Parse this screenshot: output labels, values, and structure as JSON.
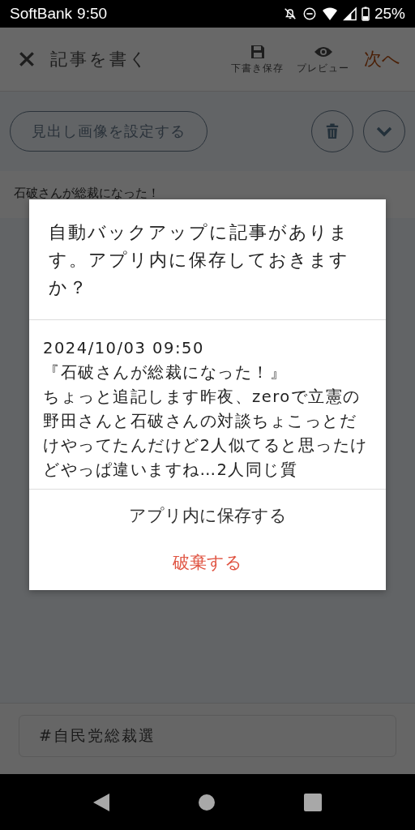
{
  "status_bar": {
    "carrier": "SoftBank",
    "time": "9:50",
    "battery": "25%"
  },
  "header": {
    "title": "記事を書く",
    "actions": [
      {
        "label": "下書き保存",
        "kind": "save"
      },
      {
        "label": "プレビュー",
        "kind": "preview"
      }
    ],
    "next": "次へ"
  },
  "toolbar": {
    "cover_button": "見出し画像を設定する"
  },
  "article_title": "石破さんが総裁になった！",
  "dialog": {
    "message": "自動バックアップに記事があります。アプリ内に保存しておきますか？",
    "date": "2024/10/03 09:50",
    "preview_title": "『石破さんが総裁になった！』",
    "preview_body": "ちょっと追記します昨夜、zeroで立憲の野田さんと石破さんの対談ちょこっとだけやってたんだけど2人似てると思ったけどやっぱ違いますね…2人同じ質",
    "buttons": [
      {
        "label": "アプリ内に保存する",
        "kind": "normal"
      },
      {
        "label": "破棄する",
        "kind": "destructive"
      }
    ]
  },
  "hashtag": "#自民党総裁選"
}
